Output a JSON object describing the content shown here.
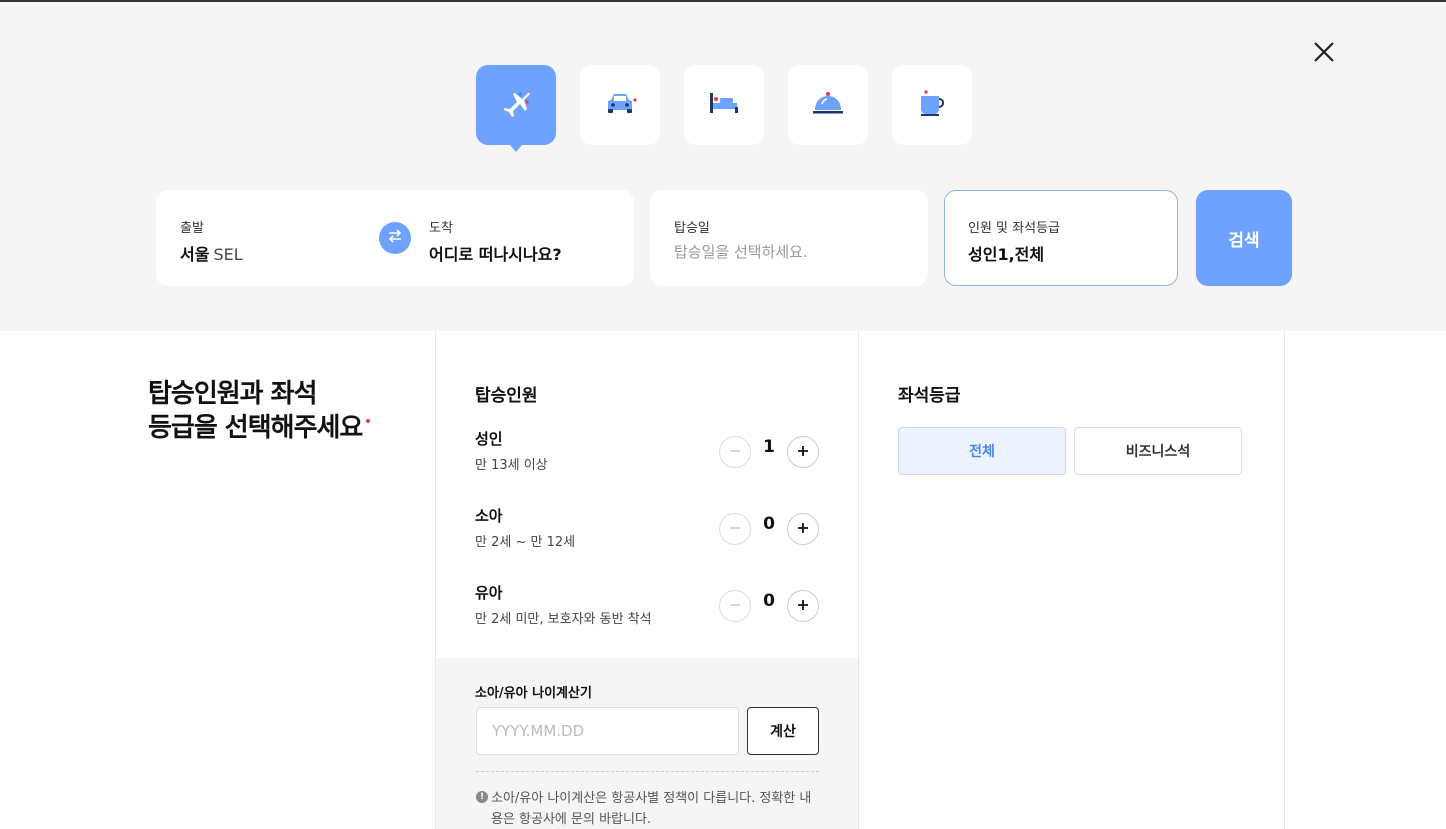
{
  "categories": [
    {
      "name": "flight",
      "icon": "airplane-icon",
      "active": true
    },
    {
      "name": "car",
      "icon": "car-icon",
      "active": false
    },
    {
      "name": "hotel",
      "icon": "bed-icon",
      "active": false
    },
    {
      "name": "restaurant",
      "icon": "cloche-icon",
      "active": false
    },
    {
      "name": "cafe",
      "icon": "coffee-cup-icon",
      "active": false
    }
  ],
  "search": {
    "departure_label": "출발",
    "departure_city": "서울",
    "departure_code": "SEL",
    "arrival_label": "도착",
    "arrival_value": "어디로 떠나시나요?",
    "date_label": "탑승일",
    "date_placeholder": "탑승일을 선택하세요.",
    "pax_label": "인원 및 좌석등급",
    "pax_value": "성인1,전체",
    "search_button": "검색"
  },
  "panel": {
    "heading_line1": "탑승인원과 좌석",
    "heading_line2": "등급을 선택해주세요",
    "passengers_title": "탑승인원",
    "passengers": [
      {
        "name": "성인",
        "desc": "만 13세 이상",
        "count": "1"
      },
      {
        "name": "소아",
        "desc": "만 2세 ~ 만 12세",
        "count": "0"
      },
      {
        "name": "유아",
        "desc": "만 2세 미만, 보호자와 동반 착석",
        "count": "0"
      }
    ],
    "calculator_title": "소아/유아 나이계산기",
    "calculator_placeholder": "YYYY.MM.DD",
    "calculator_button": "계산",
    "notice": "소아/유아 나이계산은 항공사별 정책이 다릅니다. 정확한 내용은 항공사에 문의 바랍니다.",
    "grade_title": "좌석등급",
    "grades": [
      {
        "label": "전체",
        "active": true
      },
      {
        "label": "비즈니스석",
        "active": false
      }
    ]
  },
  "colors": {
    "accent": "#6ea2ff",
    "required_dot": "#e8345c"
  }
}
